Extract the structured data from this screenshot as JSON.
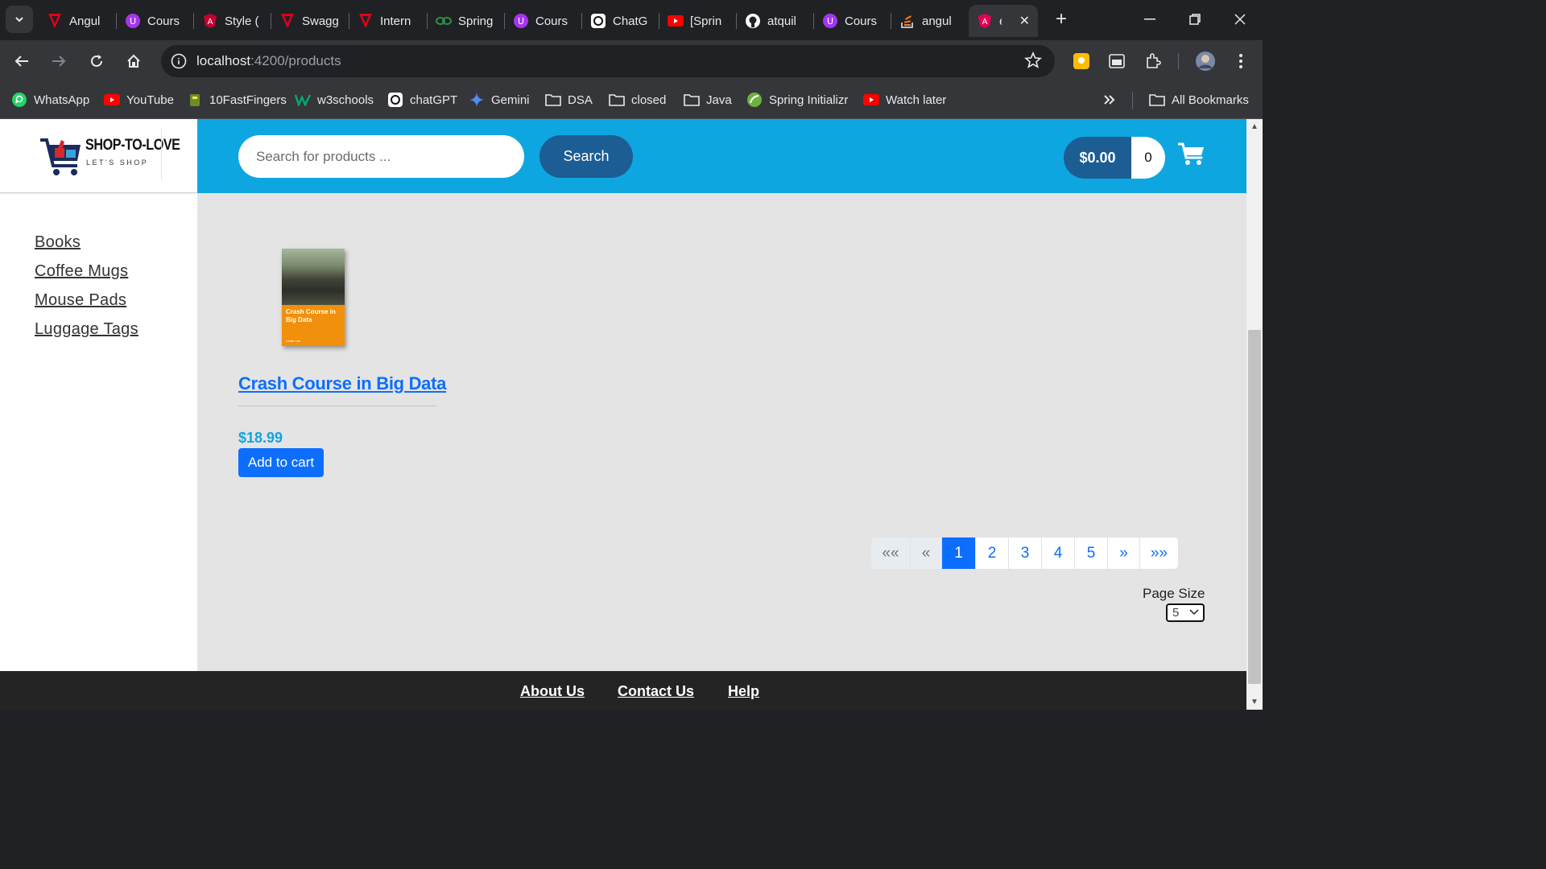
{
  "browser": {
    "tabs": [
      {
        "label": "Angul",
        "icon": "angular-red-icon"
      },
      {
        "label": "Cours",
        "icon": "udemy-icon"
      },
      {
        "label": "Style (",
        "icon": "angular-icon"
      },
      {
        "label": "Swagg",
        "icon": "angular-red-icon"
      },
      {
        "label": "Intern",
        "icon": "angular-red-icon"
      },
      {
        "label": "Spring",
        "icon": "geeks-icon"
      },
      {
        "label": "Cours",
        "icon": "udemy-icon"
      },
      {
        "label": "ChatG",
        "icon": "chatgpt-icon"
      },
      {
        "label": "[Sprin",
        "icon": "youtube-icon"
      },
      {
        "label": "atquil",
        "icon": "github-icon"
      },
      {
        "label": "Cours",
        "icon": "udemy-icon"
      },
      {
        "label": "angul",
        "icon": "stackoverflow-icon"
      },
      {
        "label": "e",
        "icon": "angular-icon"
      }
    ],
    "address": {
      "host": "localhost",
      "path": ":4200/products"
    },
    "bookmarks": [
      {
        "label": "WhatsApp",
        "icon": "whatsapp-icon"
      },
      {
        "label": "YouTube",
        "icon": "youtube-icon"
      },
      {
        "label": "10FastFingers",
        "icon": "fastfingers-icon"
      },
      {
        "label": "w3schools",
        "icon": "w3schools-icon"
      },
      {
        "label": "chatGPT",
        "icon": "chatgpt-icon"
      },
      {
        "label": "Gemini",
        "icon": "gemini-icon"
      },
      {
        "label": "DSA",
        "icon": "folder-icon"
      },
      {
        "label": "closed",
        "icon": "folder-icon"
      },
      {
        "label": "Java",
        "icon": "folder-icon"
      },
      {
        "label": "Spring Initializr",
        "icon": "spring-icon"
      },
      {
        "label": "Watch later",
        "icon": "youtube-icon"
      }
    ],
    "all_bookmarks": "All Bookmarks"
  },
  "brand": {
    "name": "SHOP-TO-LOVE",
    "tagline": "LET'S SHOP"
  },
  "categories": [
    "Books",
    "Coffee Mugs",
    "Mouse Pads",
    "Luggage Tags"
  ],
  "search": {
    "placeholder": "Search for products ...",
    "button": "Search"
  },
  "cart": {
    "total": "$0.00",
    "quantity": "0"
  },
  "products": [
    {
      "name": "Crash Course in Big Data",
      "price": "$18.99",
      "cover_title": "Crash Course in Big Data",
      "cover_author": "Leslie Lee",
      "add_button": "Add to cart"
    }
  ],
  "pagination": {
    "first": "««",
    "prev": "«",
    "pages": [
      "1",
      "2",
      "3",
      "4",
      "5"
    ],
    "active_page": "1",
    "next": "»",
    "last": "»»"
  },
  "page_size": {
    "label": "Page Size",
    "value": "5"
  },
  "footer": {
    "about": "About Us",
    "contact": "Contact Us",
    "help": "Help"
  },
  "colors": {
    "header": "#0ea6e0",
    "primary": "#0d6efd",
    "navy": "#1c5d93",
    "footer": "#242424"
  }
}
